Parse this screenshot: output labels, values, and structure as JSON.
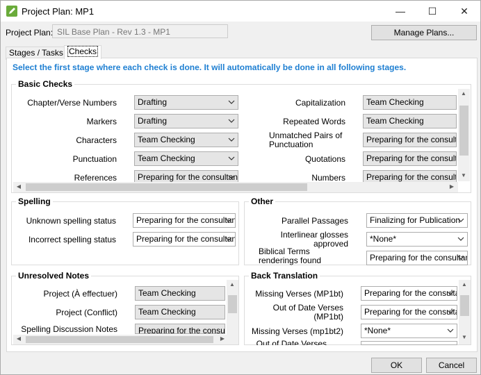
{
  "window": {
    "title": "Project Plan: MP1",
    "minimize_glyph": "—",
    "maximize_glyph": "☐",
    "close_glyph": "✕"
  },
  "header": {
    "project_plan_label": "Project Plan:",
    "project_plan_value": "SIL Base Plan - Rev 1.3 - MP1",
    "manage_plans_label": "Manage Plans..."
  },
  "tabs": [
    {
      "label": "Stages / Tasks"
    },
    {
      "label": "Checks",
      "selected": true
    }
  ],
  "instruction": "Select the first stage where each check is done. It will automatically be done in all following stages.",
  "basic_checks": {
    "title": "Basic Checks",
    "left": [
      {
        "label": "Chapter/Verse Numbers",
        "value": "Drafting"
      },
      {
        "label": "Markers",
        "value": "Drafting"
      },
      {
        "label": "Characters",
        "value": "Team Checking"
      },
      {
        "label": "Punctuation",
        "value": "Team Checking"
      },
      {
        "label": "References",
        "value": "Preparing for the consultant"
      }
    ],
    "right": [
      {
        "label": "Capitalization",
        "value": "Team Checking"
      },
      {
        "label": "Repeated Words",
        "value": "Team Checking"
      },
      {
        "label": "Unmatched Pairs of Punctuation",
        "value": "Preparing for the consultant"
      },
      {
        "label": "Quotations",
        "value": "Preparing for the consultant"
      },
      {
        "label": "Numbers",
        "value": "Preparing for the consultant"
      }
    ]
  },
  "spelling": {
    "title": "Spelling",
    "rows": [
      {
        "label": "Unknown spelling status",
        "value": "Preparing for the consultant"
      },
      {
        "label": "Incorrect spelling status",
        "value": "Preparing for the consultant"
      }
    ]
  },
  "other": {
    "title": "Other",
    "rows": [
      {
        "label": "Parallel Passages",
        "value": "Finalizing for Publication"
      },
      {
        "label": "Interlinear glosses approved",
        "value": "*None*"
      },
      {
        "label": "Biblical Terms renderings found",
        "value": "Preparing for the consultant"
      }
    ]
  },
  "unresolved_notes": {
    "title": "Unresolved Notes",
    "rows": [
      {
        "label": "Project (À effectuer)",
        "value": "Team Checking"
      },
      {
        "label": "Project (Conflict)",
        "value": "Team Checking"
      },
      {
        "label": "Spelling Discussion Notes",
        "value": "Preparing for the consultant"
      }
    ]
  },
  "back_translation": {
    "title": "Back Translation",
    "rows": [
      {
        "label": "Missing Verses (MP1bt)",
        "value": "Preparing for the consultant"
      },
      {
        "label": "Out of Date Verses (MP1bt)",
        "value": "Preparing for the consultant"
      },
      {
        "label": "Missing Verses (mp1bt2)",
        "value": "*None*"
      },
      {
        "label": "Out of Date Verses",
        "value": ""
      }
    ]
  },
  "footer": {
    "ok_label": "OK",
    "cancel_label": "Cancel"
  }
}
